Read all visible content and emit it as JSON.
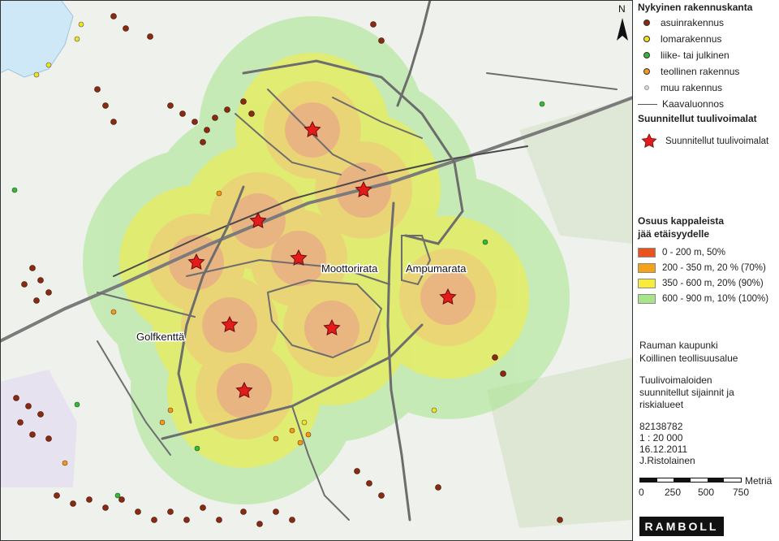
{
  "legend": {
    "buildings_title": "Nykyinen rakennuskanta",
    "buildings": [
      {
        "label": "asuinrakennus",
        "color": "#8b2a10",
        "icon": "dot-brown"
      },
      {
        "label": "lomarakennus",
        "color": "#f2e21e",
        "icon": "dot-yellow"
      },
      {
        "label": "liike- tai julkinen",
        "color": "#3ab53a",
        "icon": "dot-green"
      },
      {
        "label": "teollinen rakennus",
        "color": "#f29a20",
        "icon": "dot-orange"
      },
      {
        "label": "muu rakennus",
        "color": "#d9d9d9",
        "icon": "dot-grey"
      },
      {
        "label": "Kaavaluonnos",
        "color": "#555555",
        "icon": "line"
      }
    ],
    "turbines_title": "Suunnitellut tuulivoimalat",
    "turbine_label": "Suunnitellut tuulivoimalat",
    "zones_title_1": "Osuus kappaleista",
    "zones_title_2": "jää etäisyydelle",
    "zones": [
      {
        "label": "0 - 200 m, 50%",
        "color": "#e8541e"
      },
      {
        "label": "200 - 350 m, 20 % (70%)",
        "color": "#f5a21b"
      },
      {
        "label": "350 - 600 m, 20% (90%)",
        "color": "#f7ec3c"
      },
      {
        "label": "600 - 900 m, 10% (100%)",
        "color": "#a6e58a"
      }
    ],
    "info_1": "Rauman kaupunki",
    "info_2": "Koillinen teollisuusalue",
    "info_3": "Tuulivoimaloiden",
    "info_4": "suunnitellut sijainnit ja",
    "info_5": "riskialueet",
    "info_6": "82138782",
    "info_7": "1 : 20 000",
    "info_8": "16.12.2011",
    "info_9": "J.Ristolainen",
    "scale_unit": "Metriä",
    "scale_ticks": [
      "0",
      "250",
      "500",
      "750"
    ],
    "logo": "RAMBOLL"
  },
  "map": {
    "north": "N",
    "labels": {
      "moottorirata": "Moottorirata",
      "ampumarata": "Ampumarata",
      "golfkentta": "Golfkenttä"
    },
    "colors": {
      "zone_900": "#a6e58a",
      "zone_600": "#f7ec3c",
      "zone_350": "#f5c07a",
      "zone_200": "#e89a8a",
      "turbine": "#e41b1b",
      "road": "#6d6d6d",
      "water": "#cfe8f7",
      "base": "#eef1ec"
    }
  }
}
